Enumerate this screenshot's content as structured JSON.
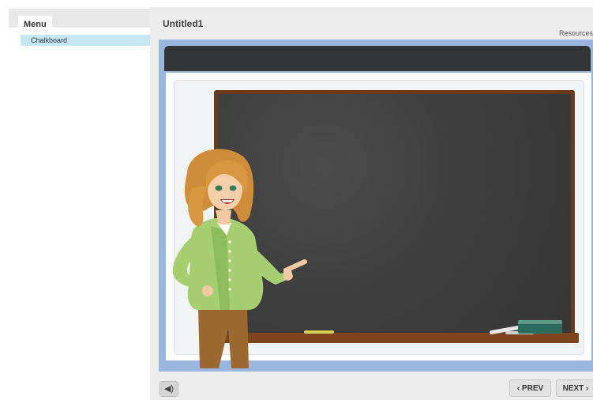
{
  "sidebar": {
    "menu_label": "Menu",
    "items": [
      {
        "label": "Chalkboard",
        "selected": true
      }
    ]
  },
  "header": {
    "title": "Untitled1",
    "resources_label": "Resources"
  },
  "controls": {
    "audio_icon": "speaker-icon",
    "prev_label": "‹ PREV",
    "next_label": "NEXT ›"
  },
  "colors": {
    "selected_item": "#c7e6f5",
    "stage_frame": "#9ab8de",
    "chalkboard": "#3e3e3e",
    "board_frame": "#6a3a1a"
  }
}
